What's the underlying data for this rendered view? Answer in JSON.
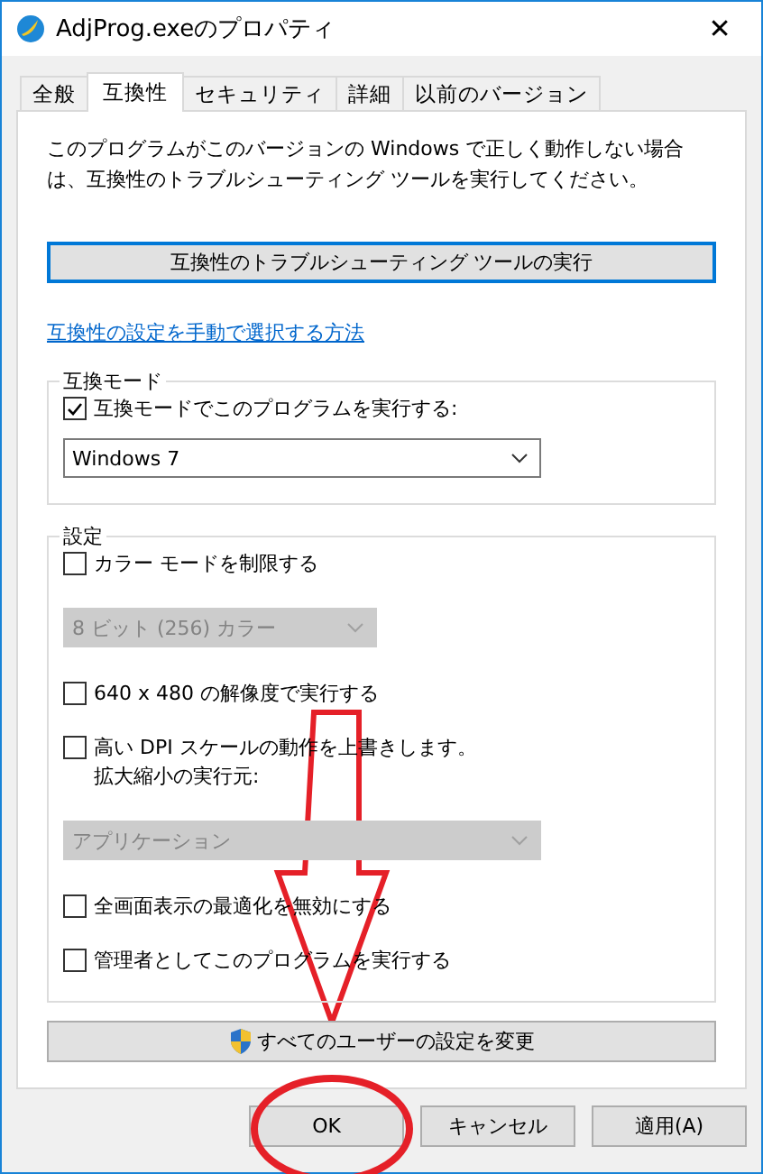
{
  "window": {
    "title": "AdjProg.exeのプロパティ",
    "close": "✕"
  },
  "tabs": [
    {
      "label": "全般",
      "selected": false
    },
    {
      "label": "互換性",
      "selected": true
    },
    {
      "label": "セキュリティ",
      "selected": false
    },
    {
      "label": "詳細",
      "selected": false
    },
    {
      "label": "以前のバージョン",
      "selected": false
    }
  ],
  "intro": "このプログラムがこのバージョンの Windows で正しく動作しない場合は、互換性のトラブルシューティング ツールを実行してください。",
  "troubleshoot_button": "互換性のトラブルシューティング ツールの実行",
  "manual_link": "互換性の設定を手動で選択する方法",
  "compat_mode": {
    "legend": "互換モード",
    "items": [
      {
        "kind": "checkbox",
        "label": "互換モードでこのプログラムを実行する:",
        "checked": true
      },
      {
        "kind": "select",
        "value": "Windows 7",
        "disabled": false,
        "wide": true
      }
    ]
  },
  "settings": {
    "legend": "設定",
    "items": [
      {
        "kind": "checkbox",
        "label": "カラー モードを制限する",
        "checked": false
      },
      {
        "kind": "select",
        "value": "8 ビット (256) カラー",
        "disabled": true,
        "wide": false
      },
      {
        "kind": "checkbox",
        "label": "640 x 480 の解像度で実行する",
        "checked": false
      },
      {
        "kind": "checkbox",
        "label": "高い DPI スケールの動作を上書きします。",
        "label_2": "拡大縮小の実行元:",
        "checked": false
      },
      {
        "kind": "select",
        "value": "アプリケーション",
        "disabled": true,
        "wide": true
      },
      {
        "kind": "checkbox",
        "label": "全画面表示の最適化を無効にする",
        "checked": false
      },
      {
        "kind": "checkbox",
        "label": "管理者としてこのプログラムを実行する",
        "checked": false
      }
    ]
  },
  "all_users_button": "すべてのユーザーの設定を変更",
  "buttons": [
    "OK",
    "キャンセル",
    "適用(A)"
  ]
}
